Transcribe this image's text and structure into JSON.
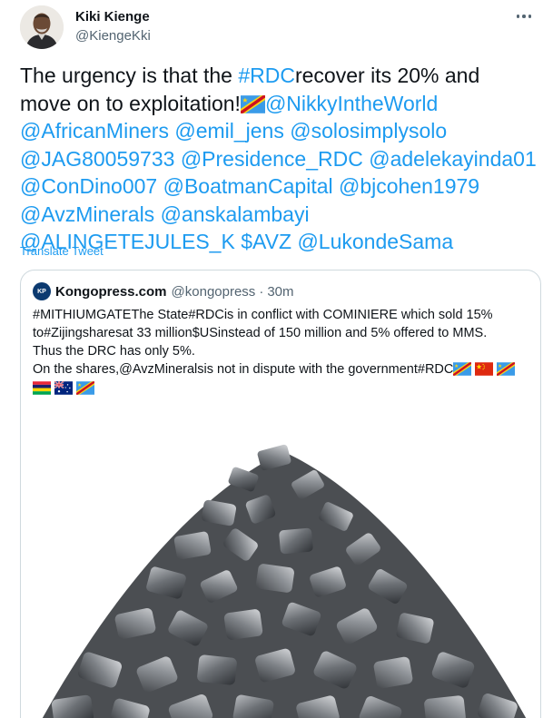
{
  "tweet": {
    "author_name": "Kiki Kienge",
    "author_handle": "@KiengeKki",
    "text": {
      "l1_a": "The urgency is that the ",
      "l1_tag": "#RDC",
      "l1_b": "recover its 20% and",
      "l2_a": "move on to exploitation!",
      "l2_m1": "@NikkyIntheWorld",
      "l3_m1": "@AfricanMiners",
      "l3_m2": "@emil_jens",
      "l3_m3": "@solosimplysolo",
      "l4_m1": "@JAG80059733",
      "l4_m2": "@Presidence_RDC",
      "l4_m3": "@adelekayinda01",
      "l5_m1": "@ConDino007",
      "l5_m2": "@BoatmanCapital",
      "l5_m3": "@bjcohen1979",
      "l6_m1": "@AvzMinerals",
      "l6_m2": "@anskalambayi",
      "l7_m1": "@ALINGETEJULES_K",
      "l7_m2": "$AVZ",
      "l7_m3": "@LukondeSama"
    },
    "translate_label": "Translate Tweet"
  },
  "quoted": {
    "avatar_text": "KP",
    "name": "Kongopress.com",
    "handle": "@kongopress",
    "separator": "·",
    "time": "30m",
    "lines": [
      "#MITHIUMGATEThe State#RDCis in conflict with COMINIERE which sold 15%",
      "to#Zijingsharesat 33 million$USinstead of 150 million and 5% offered to MMS.",
      "Thus the DRC has only 5%.",
      "On the shares,@AvzMineralsis not in dispute with the government#RDC"
    ]
  },
  "colors": {
    "link": "#1d9bf0",
    "text": "#0f1419",
    "secondary": "#536471",
    "border": "#cfd9de"
  },
  "icons": [
    "more-options-icon",
    "drc-flag-icon",
    "china-flag-icon",
    "mauritius-flag-icon",
    "australia-flag-icon"
  ]
}
